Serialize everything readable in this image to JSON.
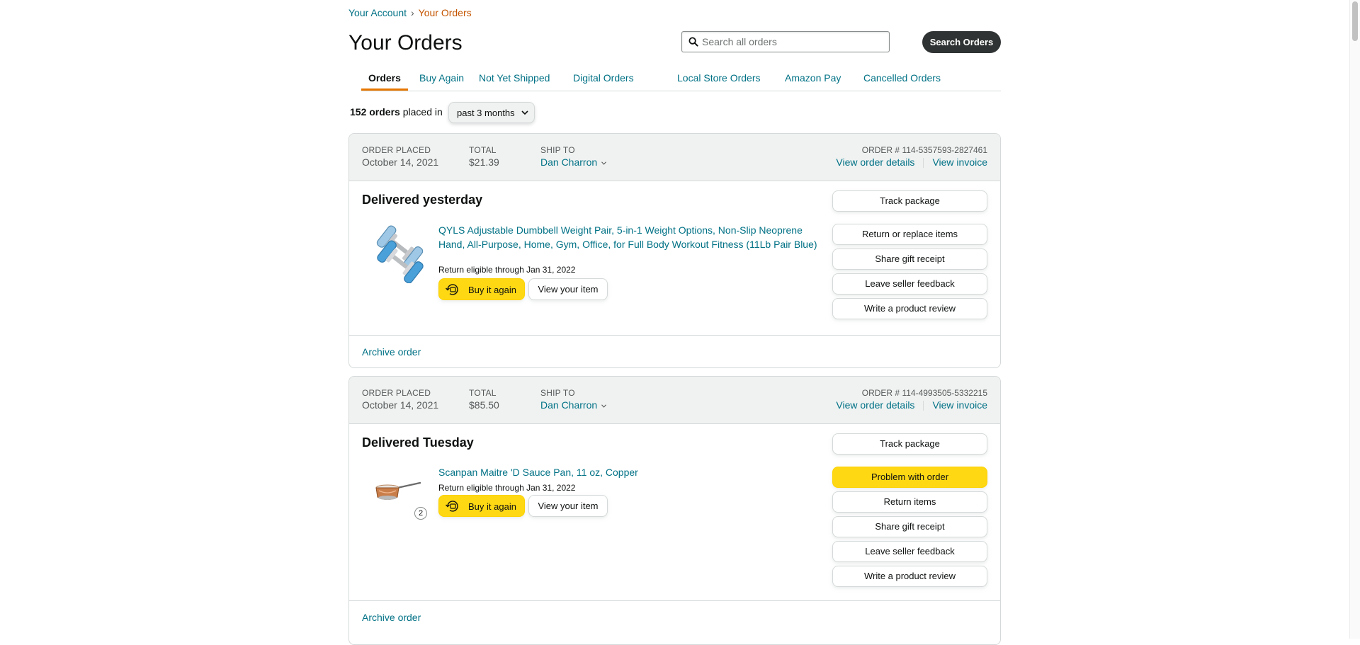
{
  "breadcrumb": {
    "parent": "Your Account",
    "separator": "›",
    "current": "Your Orders"
  },
  "page_title": "Your Orders",
  "search": {
    "placeholder": "Search all orders",
    "value": "",
    "button_label": "Search Orders"
  },
  "tabs": [
    "Orders",
    "Buy Again",
    "Not Yet Shipped",
    "Digital Orders",
    "Local Store Orders",
    "Amazon Pay",
    "Cancelled Orders"
  ],
  "active_tab": "Orders",
  "summary": {
    "count": "152 orders",
    "text": "placed in",
    "period": "past 3 months"
  },
  "header_labels": {
    "order_placed": "Order placed",
    "total": "Total",
    "ship_to": "Ship to",
    "view_details": "View order details",
    "view_invoice": "View invoice"
  },
  "orders": [
    {
      "placed": "October 14, 2021",
      "total": "$21.39",
      "ship_to": "Dan Charron",
      "order_number": "ORDER # 114-5357593-2827461",
      "status": "Delivered yesterday",
      "item_title": "QYLS Adjustable Dumbbell Weight Pair, 5-in-1 Weight Options, Non-Slip Neoprene Hand, All-Purpose, Home, Gym, Office, for Full Body Workout Fitness (11Lb Pair Blue)",
      "return_eligible": "Return eligible through Jan 31, 2022",
      "buy_again": "Buy it again",
      "view_item": "View your item",
      "actions": [
        "Track package",
        "Return or replace items",
        "Share gift receipt",
        "Leave seller feedback",
        "Write a product review"
      ],
      "archive": "Archive order"
    },
    {
      "placed": "October 14, 2021",
      "total": "$85.50",
      "ship_to": "Dan Charron",
      "order_number": "ORDER # 114-4993505-5332215",
      "status": "Delivered Tuesday",
      "item_title": "Scanpan Maitre 'D Sauce Pan, 11 oz, Copper",
      "return_eligible": "Return eligible through Jan 31, 2022",
      "quantity": "2",
      "buy_again": "Buy it again",
      "view_item": "View your item",
      "actions": [
        "Track package",
        "Problem with order",
        "Return items",
        "Share gift receipt",
        "Leave seller feedback",
        "Write a product review"
      ],
      "archive": "Archive order"
    }
  ],
  "colors": {
    "link": "#007185",
    "accent_orange": "#e77600",
    "button_yellow": "#ffd814",
    "header_bg": "#f0f2f2"
  },
  "icons": [
    "search-icon",
    "chevron-down-icon",
    "caret-down-icon",
    "buy-again-icon"
  ]
}
